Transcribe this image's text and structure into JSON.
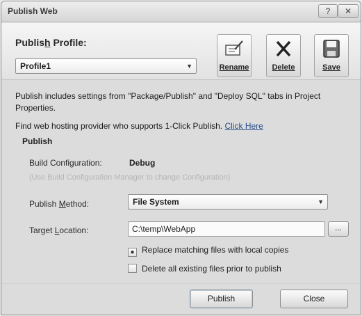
{
  "window": {
    "title": "Publish Web",
    "help_glyph": "?",
    "close_glyph": "✕"
  },
  "profile": {
    "label": "Publish Profile:",
    "selected": "Profile1"
  },
  "toolbar": {
    "rename": {
      "label": "Rename",
      "icon": "rename-icon",
      "glyph": "✎"
    },
    "delete": {
      "label": "Delete",
      "icon": "delete-icon",
      "glyph": "✕"
    },
    "save": {
      "label": "Save",
      "icon": "save-icon",
      "glyph": "💾"
    }
  },
  "info": {
    "settings_note": "Publish includes settings from \"Package/Publish\" and \"Deploy SQL\" tabs in Project Properties.",
    "hosting_note": "Find web hosting provider who supports 1-Click Publish.",
    "hosting_link": "Click Here"
  },
  "publish_section": {
    "title": "Publish",
    "build_config_label": "Build Configuration:",
    "build_config_value": "Debug",
    "hint": "(Use Build Configuration Manager to change Configuration)",
    "method_label": "Publish Method:",
    "method_value": "File System",
    "target_label": "Target Location:",
    "target_value": "C:\\temp\\WebApp",
    "browse_label": "...",
    "option_replace": {
      "label": "Replace matching files with local copies",
      "checked": true
    },
    "option_delete": {
      "label": "Delete all existing files prior to publish",
      "checked": false
    }
  },
  "buttons": {
    "publish": "Publish",
    "close": "Close"
  },
  "colors": {
    "background": "#dcdcdc",
    "link": "#2a4f8f",
    "hint": "#b5b5b5"
  }
}
